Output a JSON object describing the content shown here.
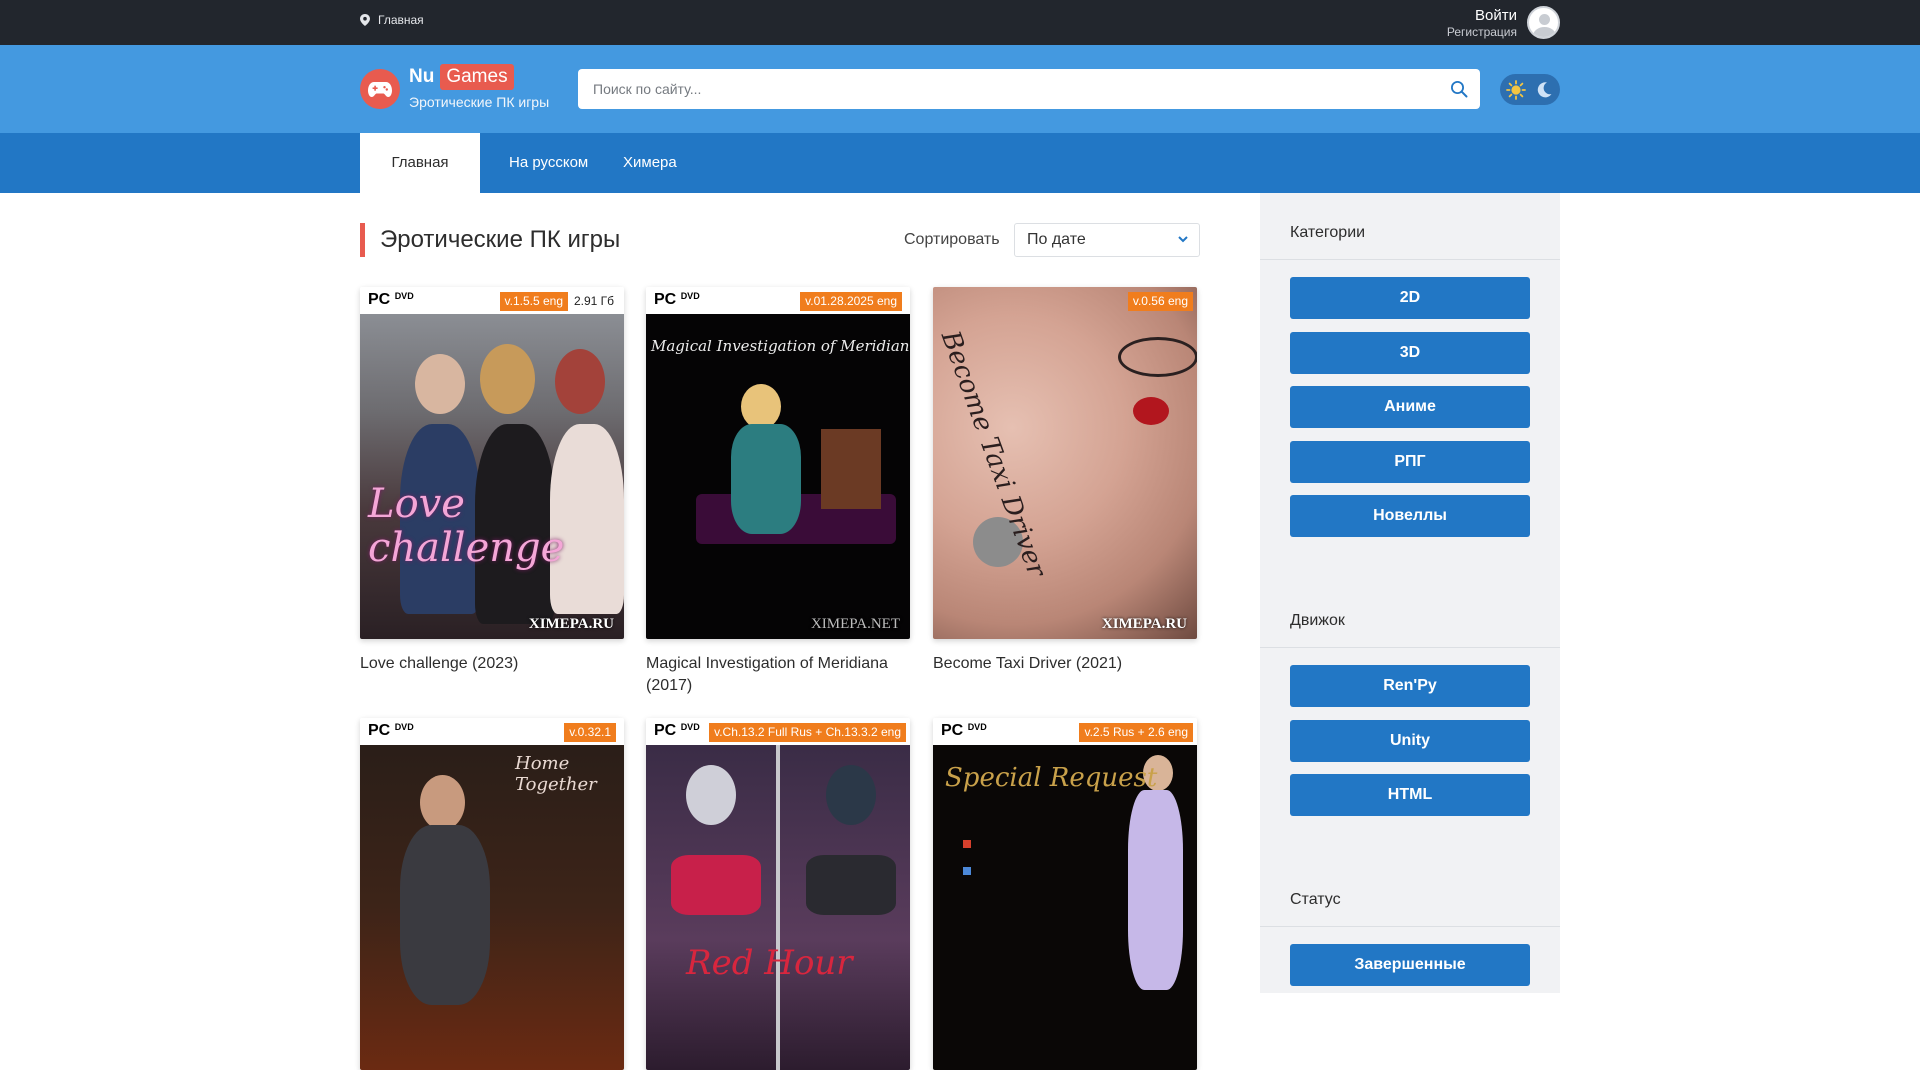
{
  "topbar": {
    "crumb": "Главная",
    "login": "Войти",
    "register": "Регистрация"
  },
  "header": {
    "logo_prefix": "Nu",
    "logo_highlight": "Games",
    "tagline": "Эротические ПК игры",
    "search_placeholder": "Поиск по сайту..."
  },
  "nav": {
    "tabs": [
      "Главная",
      "На русском",
      "Химера"
    ]
  },
  "page": {
    "title": "Эротические ПК игры",
    "sort_label": "Сортировать",
    "sort_value": "По дате"
  },
  "cards": [
    {
      "version": "v.1.5.5 eng",
      "size": "2.91 Гб",
      "title": "Love challenge (2023)",
      "watermark": "XIMEPA.RU",
      "cover_text": "Love challenge"
    },
    {
      "version": "v.01.28.2025 eng",
      "title": "Magical Investigation of Meridiana (2017)",
      "watermark": "XIMEPA.NET",
      "cover_text": "Magical Investigation of Meridiana"
    },
    {
      "version": "v.0.56 eng",
      "title": "Become Taxi Driver (2021)",
      "watermark": "XIMEPA.RU",
      "cover_text": "Become Taxi Driver"
    },
    {
      "version": "v.0.32.1",
      "title": "",
      "cover_text": "Home Together"
    },
    {
      "version": "v.Ch.13.2 Full Rus + Ch.13.3.2 eng",
      "title": "",
      "cover_text": "Red Hour"
    },
    {
      "version": "v.2.5 Rus + 2.6 eng",
      "title": "",
      "cover_text": "Special Request"
    }
  ],
  "cover_brand": {
    "pc": "PC",
    "dvd": "DVD"
  },
  "sidebar": {
    "categories_title": "Категории",
    "categories": [
      "2D",
      "3D",
      "Аниме",
      "РПГ",
      "Новеллы"
    ],
    "engine_title": "Движок",
    "engines": [
      "Ren'Py",
      "Unity",
      "HTML"
    ],
    "status_title": "Статус",
    "statuses": [
      "Завершенные"
    ]
  },
  "colors": {
    "accent": "#e85b4f",
    "header": "#4499e0",
    "nav": "#2277c5",
    "topbar": "#22262d",
    "badge": "#f07d1d"
  }
}
